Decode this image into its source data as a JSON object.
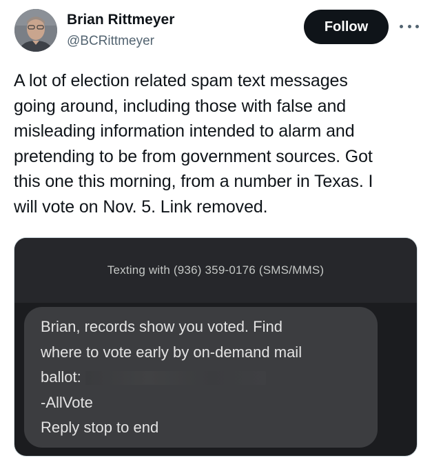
{
  "tweet": {
    "author_name": "Brian Rittmeyer",
    "author_handle": "@BCRittmeyer",
    "follow_label": "Follow",
    "text": "A lot of election related spam text messages\ngoing around, including those with false and\nmisleading information intended to alarm and\npretending to be from government sources. Got\nthis one this morning, from a number in Texas. I\nwill vote on Nov. 5. Link removed."
  },
  "sms": {
    "header": "Texting with (936) 359-0176 (SMS/MMS)",
    "message_lines": [
      "Brian, records show you voted. Find",
      "where to vote early by on-demand mail",
      "ballot:",
      "-AllVote",
      "Reply stop to end"
    ]
  },
  "colors": {
    "follow_bg": "#0f1419",
    "text_primary": "#0f1419",
    "text_secondary": "#536471",
    "sms_background": "#1b1c1f",
    "bubble": "#3c3d40"
  }
}
